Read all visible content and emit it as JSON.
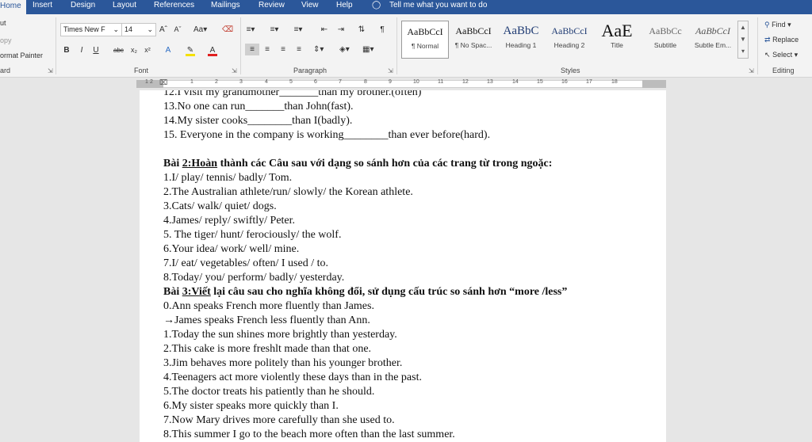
{
  "tabs": [
    "Home",
    "Insert",
    "Design",
    "Layout",
    "References",
    "Mailings",
    "Review",
    "View",
    "Help"
  ],
  "tell_me": "Tell me what you want to do",
  "clipboard": {
    "cut": "ut",
    "copy": "opy",
    "format_painter": "ormat Painter",
    "group": "ard"
  },
  "font": {
    "name": "Times New F",
    "size": "14",
    "group": "Font"
  },
  "paragraph": {
    "group": "Paragraph"
  },
  "styles": {
    "group": "Styles",
    "items": [
      {
        "preview": "AaBbCcI",
        "name": "¶ Normal"
      },
      {
        "preview": "AaBbCcI",
        "name": "¶ No Spac..."
      },
      {
        "preview": "AaBbC",
        "name": "Heading 1"
      },
      {
        "preview": "AaBbCcI",
        "name": "Heading 2"
      },
      {
        "preview": "AaE",
        "name": "Title"
      },
      {
        "preview": "AaBbCc",
        "name": "Subtitle"
      },
      {
        "preview": "AaBbCcI",
        "name": "Subtle Em..."
      }
    ]
  },
  "editing": {
    "find": "Find",
    "replace": "Replace",
    "select": "Select",
    "group": "Editing"
  },
  "ruler_numbers": [
    "1",
    "2",
    "1",
    "2",
    "3",
    "4",
    "5",
    "6",
    "7",
    "8",
    "9",
    "10",
    "11",
    "12",
    "13",
    "14",
    "15",
    "16",
    "17",
    "18"
  ],
  "document": {
    "l0": "12.I visit my grandmother_______than my brother.(often)",
    "l1": "13.No one can run_______than John(fast).",
    "l2": "14.My sister cooks________than I(badly).",
    "l3": "15. Everyone in the company is working________than ever before(hard).",
    "b2_prefix": "Bài ",
    "b2_num": "2:Hoàn",
    "b2_rest": " thành các Câu sau với dạng so sánh hơn của các trang từ trong ngoặc:",
    "b2_items": [
      "1.I/ play/ tennis/ badly/ Tom.",
      "2.The Australian athlete/run/ slowly/ the Korean athlete.",
      "3.Cats/ walk/ quiet/ dogs.",
      "4.James/ reply/ swiftly/ Peter.",
      "5. The tiger/ hunt/ ferociously/ the wolf.",
      "6.Your idea/ work/ well/ mine.",
      "7.I/ eat/ vegetables/ often/ I used / to.",
      "8.Today/ you/ perform/ badly/ yesterday."
    ],
    "b3_prefix": "Bài ",
    "b3_num": "3:Viết",
    "b3_rest": " lại câu sau cho nghĩa không đổi, sử dụng cấu trúc so sánh hơn “more /less”",
    "b3_items": [
      "0.Ann speaks French more fluently than James.",
      "→James speaks French less fluently than Ann.",
      "1.Today the sun shines more brightly than yesterday.",
      "2.This cake is more freshlt made than that one.",
      "3.Jim behaves more politely than his younger brother.",
      "4.Teenagers act more violently these days than in the past.",
      "5.The doctor treats his patiently than he should.",
      "6.My sister speaks more quickly than I.",
      "7.Now Mary drives more carefully than  she used to.",
      "8.This summer I go to the beach more often than the last summer."
    ]
  }
}
